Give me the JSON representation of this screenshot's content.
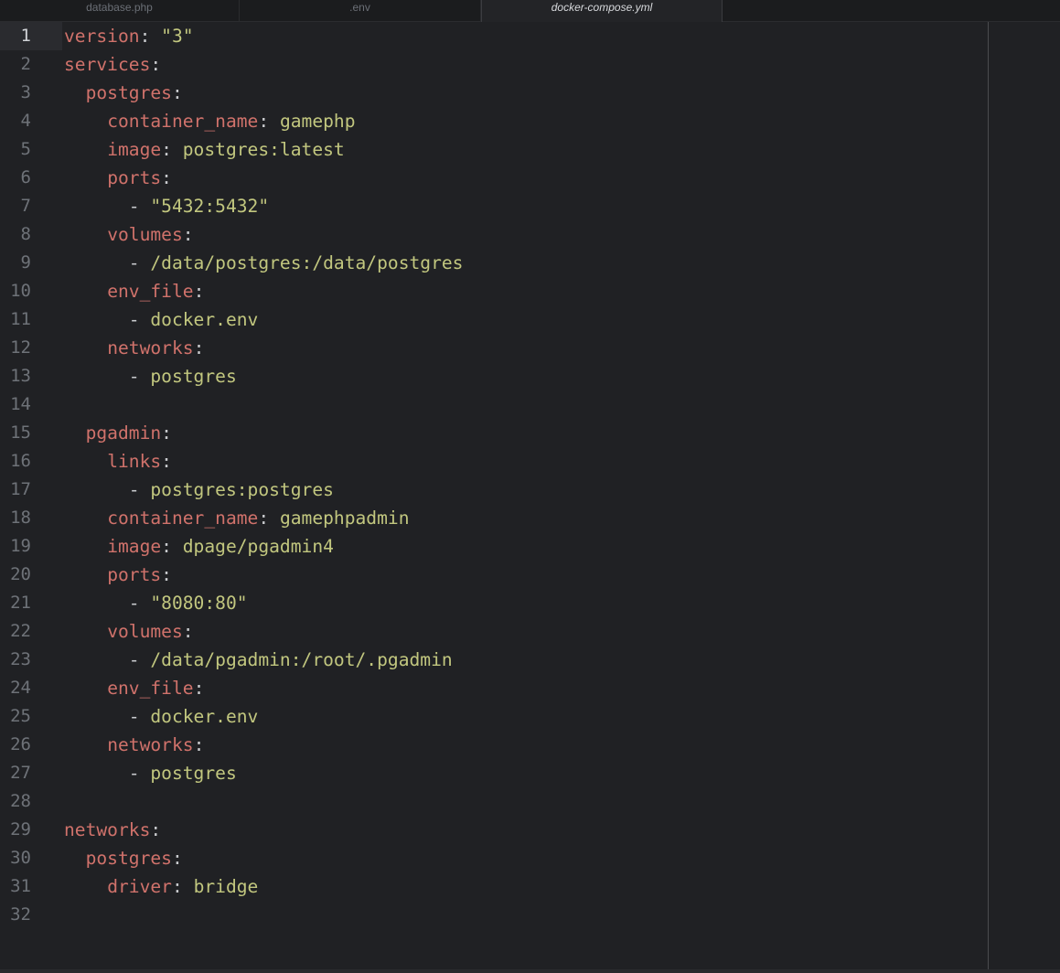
{
  "tabs": [
    {
      "label": "database.php",
      "active": false
    },
    {
      "label": ".env",
      "active": false
    },
    {
      "label": "docker-compose.yml",
      "active": true
    }
  ],
  "editor": {
    "current_line": 1,
    "lines": [
      {
        "number": "1",
        "indent": "",
        "dash": "",
        "key": "version",
        "value": "\"3\""
      },
      {
        "number": "2",
        "indent": "",
        "dash": "",
        "key": "services",
        "value": ""
      },
      {
        "number": "3",
        "indent": "  ",
        "dash": "",
        "key": "postgres",
        "value": ""
      },
      {
        "number": "4",
        "indent": "    ",
        "dash": "",
        "key": "container_name",
        "value": "gamephp"
      },
      {
        "number": "5",
        "indent": "    ",
        "dash": "",
        "key": "image",
        "value": "postgres:latest"
      },
      {
        "number": "6",
        "indent": "    ",
        "dash": "",
        "key": "ports",
        "value": ""
      },
      {
        "number": "7",
        "indent": "      ",
        "dash": "- ",
        "key": "",
        "value": "\"5432:5432\""
      },
      {
        "number": "8",
        "indent": "    ",
        "dash": "",
        "key": "volumes",
        "value": ""
      },
      {
        "number": "9",
        "indent": "      ",
        "dash": "- ",
        "key": "",
        "value": "/data/postgres:/data/postgres"
      },
      {
        "number": "10",
        "indent": "    ",
        "dash": "",
        "key": "env_file",
        "value": ""
      },
      {
        "number": "11",
        "indent": "      ",
        "dash": "- ",
        "key": "",
        "value": "docker.env"
      },
      {
        "number": "12",
        "indent": "    ",
        "dash": "",
        "key": "networks",
        "value": ""
      },
      {
        "number": "13",
        "indent": "      ",
        "dash": "- ",
        "key": "",
        "value": "postgres"
      },
      {
        "number": "14",
        "indent": "",
        "dash": "",
        "key": "",
        "value": ""
      },
      {
        "number": "15",
        "indent": "  ",
        "dash": "",
        "key": "pgadmin",
        "value": ""
      },
      {
        "number": "16",
        "indent": "    ",
        "dash": "",
        "key": "links",
        "value": ""
      },
      {
        "number": "17",
        "indent": "      ",
        "dash": "- ",
        "key": "",
        "value": "postgres:postgres"
      },
      {
        "number": "18",
        "indent": "    ",
        "dash": "",
        "key": "container_name",
        "value": "gamephpadmin"
      },
      {
        "number": "19",
        "indent": "    ",
        "dash": "",
        "key": "image",
        "value": "dpage/pgadmin4"
      },
      {
        "number": "20",
        "indent": "    ",
        "dash": "",
        "key": "ports",
        "value": ""
      },
      {
        "number": "21",
        "indent": "      ",
        "dash": "- ",
        "key": "",
        "value": "\"8080:80\""
      },
      {
        "number": "22",
        "indent": "    ",
        "dash": "",
        "key": "volumes",
        "value": ""
      },
      {
        "number": "23",
        "indent": "      ",
        "dash": "- ",
        "key": "",
        "value": "/data/pgadmin:/root/.pgadmin"
      },
      {
        "number": "24",
        "indent": "    ",
        "dash": "",
        "key": "env_file",
        "value": ""
      },
      {
        "number": "25",
        "indent": "      ",
        "dash": "- ",
        "key": "",
        "value": "docker.env"
      },
      {
        "number": "26",
        "indent": "    ",
        "dash": "",
        "key": "networks",
        "value": ""
      },
      {
        "number": "27",
        "indent": "      ",
        "dash": "- ",
        "key": "",
        "value": "postgres"
      },
      {
        "number": "28",
        "indent": "",
        "dash": "",
        "key": "",
        "value": ""
      },
      {
        "number": "29",
        "indent": "",
        "dash": "",
        "key": "networks",
        "value": ""
      },
      {
        "number": "30",
        "indent": "  ",
        "dash": "",
        "key": "postgres",
        "value": ""
      },
      {
        "number": "31",
        "indent": "    ",
        "dash": "",
        "key": "driver",
        "value": "bridge"
      },
      {
        "number": "32",
        "indent": "",
        "dash": "",
        "key": "",
        "value": ""
      }
    ]
  },
  "colors": {
    "background": "#202124",
    "key": "#d0726b",
    "string": "#c2c77f",
    "line_number": "#6e7278"
  }
}
